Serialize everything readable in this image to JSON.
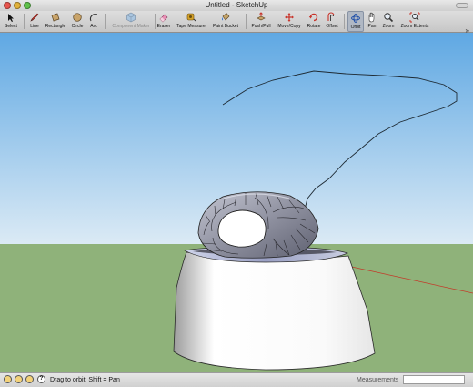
{
  "window": {
    "title": "Untitled - SketchUp"
  },
  "toolbar": {
    "tools": [
      {
        "id": "select",
        "label": "Select",
        "icon": "arrow-cursor-icon"
      },
      {
        "id": "line",
        "label": "Line",
        "icon": "pencil-icon"
      },
      {
        "id": "rectangle",
        "label": "Rectangle",
        "icon": "rectangle-icon"
      },
      {
        "id": "circle",
        "label": "Circle",
        "icon": "circle-icon"
      },
      {
        "id": "arc",
        "label": "Arc",
        "icon": "arc-icon"
      },
      {
        "id": "component-maker",
        "label": "Component Maker",
        "icon": "component-icon",
        "disabled": true
      },
      {
        "id": "eraser",
        "label": "Eraser",
        "icon": "eraser-icon"
      },
      {
        "id": "tape-measure",
        "label": "Tape Measure",
        "icon": "tape-measure-icon"
      },
      {
        "id": "paint-bucket",
        "label": "Paint Bucket",
        "icon": "paint-bucket-icon"
      },
      {
        "id": "push-pull",
        "label": "Push/Pull",
        "icon": "push-pull-icon"
      },
      {
        "id": "move-copy",
        "label": "Move/Copy",
        "icon": "move-icon"
      },
      {
        "id": "rotate",
        "label": "Rotate",
        "icon": "rotate-icon"
      },
      {
        "id": "offset",
        "label": "Offset",
        "icon": "offset-icon"
      },
      {
        "id": "orbit",
        "label": "Orbit",
        "icon": "orbit-icon",
        "active": true
      },
      {
        "id": "pan",
        "label": "Pan",
        "icon": "hand-icon"
      },
      {
        "id": "zoom",
        "label": "Zoom",
        "icon": "magnifier-icon"
      },
      {
        "id": "zoom-extents",
        "label": "Zoom Extents",
        "icon": "zoom-extents-icon"
      }
    ],
    "overflow_label": "»"
  },
  "statusbar": {
    "hint": "Drag to orbit.  Shift = Pan",
    "measurements_label": "Measurements",
    "measurements_value": "",
    "help_glyph": "?"
  },
  "colors": {
    "sky_top": "#5fa8e3",
    "sky_bottom": "#dbeaf5",
    "ground": "#8fb27a",
    "red_axis": "#c23b2a"
  }
}
